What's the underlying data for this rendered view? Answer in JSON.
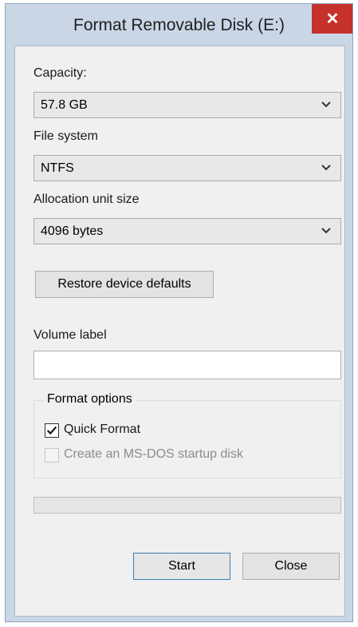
{
  "window": {
    "title": "Format Removable Disk (E:)",
    "close_glyph": "✕"
  },
  "capacity": {
    "label": "Capacity:",
    "value": "57.8 GB"
  },
  "file_system": {
    "label": "File system",
    "value": "NTFS"
  },
  "allocation": {
    "label": "Allocation unit size",
    "value": "4096 bytes"
  },
  "restore_button": "Restore device defaults",
  "volume": {
    "label": "Volume label",
    "value": ""
  },
  "format_options": {
    "title": "Format options",
    "quick_format": {
      "label": "Quick Format",
      "checked": true
    },
    "msdos": {
      "label": "Create an MS-DOS startup disk",
      "checked": false,
      "enabled": false
    }
  },
  "progress": {
    "fraction": 0
  },
  "buttons": {
    "start": "Start",
    "close": "Close"
  },
  "icons": {
    "dropdown": "chevron-down-icon",
    "close": "close-icon",
    "check": "checkmark-icon"
  }
}
